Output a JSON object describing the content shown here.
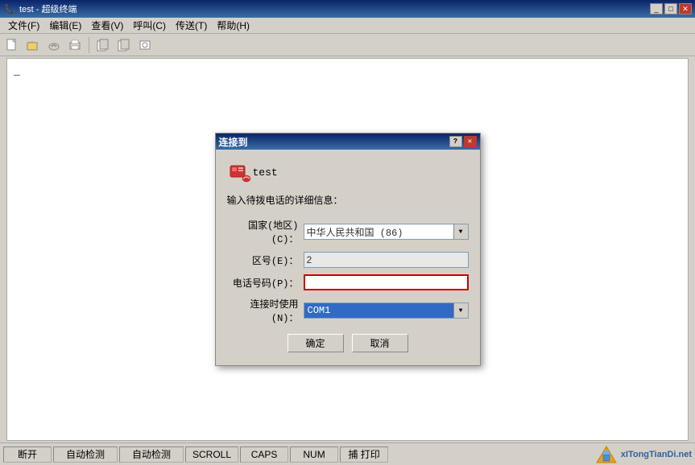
{
  "window": {
    "title": "test - 超级终端",
    "icon": "📞"
  },
  "menu": {
    "items": [
      {
        "label": "文件(F)",
        "id": "file"
      },
      {
        "label": "编辑(E)",
        "id": "edit"
      },
      {
        "label": "查看(V)",
        "id": "view"
      },
      {
        "label": "呼叫(C)",
        "id": "call"
      },
      {
        "label": "传送(T)",
        "id": "transfer"
      },
      {
        "label": "帮助(H)",
        "id": "help"
      }
    ]
  },
  "toolbar": {
    "buttons": [
      {
        "icon": "📄",
        "name": "new"
      },
      {
        "icon": "📂",
        "name": "open"
      },
      {
        "icon": "📞",
        "name": "dial"
      },
      {
        "icon": "🖨",
        "name": "print"
      },
      {
        "icon": "📋",
        "name": "copy1"
      },
      {
        "icon": "📋",
        "name": "copy2"
      },
      {
        "icon": "📸",
        "name": "capture"
      }
    ]
  },
  "dialog": {
    "title": "连接到",
    "connection_name": "test",
    "description": "输入待拨电话的详细信息：",
    "fields": {
      "country_label": "国家(地区)(C)：",
      "country_value": "中华人民共和国 (86)",
      "area_label": "区号(E)：",
      "area_value": "2",
      "phone_label": "电话号码(P)：",
      "phone_value": "",
      "connect_label": "连接时使用(N)：",
      "connect_value": "COM1"
    },
    "buttons": {
      "confirm": "确定",
      "cancel": "取消"
    }
  },
  "statusbar": {
    "items": [
      {
        "label": "断开",
        "id": "disconnect"
      },
      {
        "label": "自动检测",
        "id": "auto1"
      },
      {
        "label": "自动检测",
        "id": "auto2"
      },
      {
        "label": "SCROLL",
        "id": "scroll"
      },
      {
        "label": "CAPS",
        "id": "caps"
      },
      {
        "label": "NUM",
        "id": "num"
      },
      {
        "label": "捕 打印",
        "id": "capture"
      }
    ]
  },
  "watermark": {
    "text": "xITongTianDi.net"
  },
  "colors": {
    "title_bar_start": "#0a246a",
    "title_bar_end": "#3a6ea5",
    "dialog_highlight_border": "#cc0000",
    "select_bg": "#316ac5"
  }
}
